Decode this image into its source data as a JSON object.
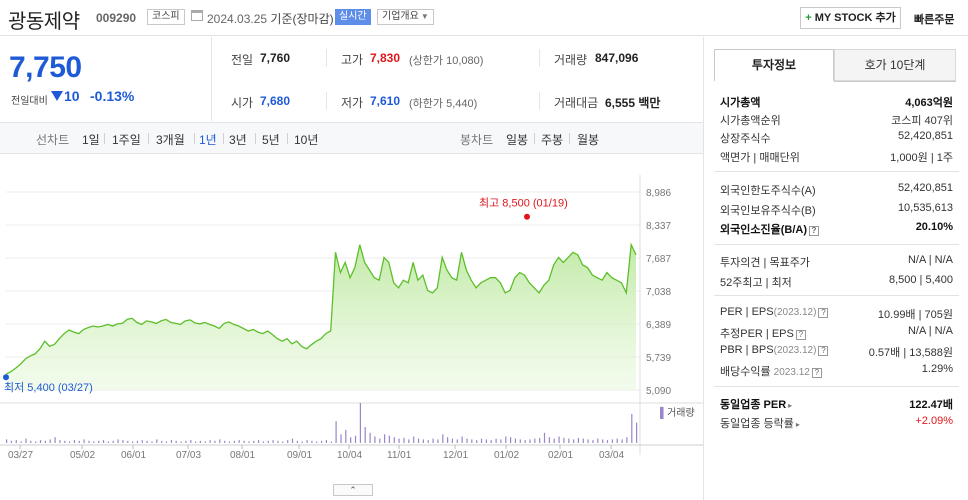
{
  "header": {
    "stock_name": "광동제약",
    "stock_code": "009290",
    "market": "코스피",
    "date": "2024.03.25",
    "basis": "기준(장마감)",
    "realtime_label": "실시간",
    "overview_label": "기업개요",
    "mystock_label": "MY STOCK 추가",
    "quick_order_label": "빠른주문"
  },
  "price": {
    "current": "7,750",
    "change_label": "전일대비",
    "change": "10",
    "change_rate": "-0.13%"
  },
  "summary": {
    "prev_close_label": "전일",
    "prev_close": "7,760",
    "high_label": "고가",
    "high": "7,830",
    "upper_limit": "(상한가 10,080)",
    "volume_label": "거래량",
    "volume": "847,096",
    "open_label": "시가",
    "open": "7,680",
    "low_label": "저가",
    "low": "7,610",
    "lower_limit": "(하한가 5,440)",
    "amount_label": "거래대금",
    "amount": "6,555",
    "amount_unit": "백만"
  },
  "periods": {
    "line_label": "선차트",
    "items": [
      "1일",
      "1주일",
      "3개월",
      "1년",
      "3년",
      "5년",
      "10년"
    ],
    "active_index": 3,
    "candle_label": "봉차트",
    "candle_items": [
      "일봉",
      "주봉",
      "월봉"
    ]
  },
  "chart_data": {
    "type": "area",
    "title": "",
    "ylim": [
      5090,
      8986
    ],
    "y_ticks": [
      "8,986",
      "8,337",
      "7,687",
      "7,038",
      "6,389",
      "5,739",
      "5,090"
    ],
    "x_ticks": [
      "03/27",
      "05/02",
      "06/01",
      "07/03",
      "08/01",
      "09/01",
      "10/04",
      "11/01",
      "12/01",
      "01/02",
      "02/01",
      "03/04"
    ],
    "high_label": "최고 8,500 (01/19)",
    "low_label": "최저 5,400 (03/27)",
    "volume_label": "거래량",
    "price_values": [
      5400,
      5450,
      5520,
      5600,
      5700,
      5760,
      5800,
      5900,
      6050,
      5950,
      5990,
      6100,
      6200,
      6270,
      6230,
      6200,
      6280,
      6320,
      6350,
      6330,
      6350,
      6380,
      6350,
      6390,
      6400,
      6480,
      6500,
      6420,
      6380,
      6450,
      6430,
      6400,
      6450,
      6480,
      6420,
      6400,
      6380,
      6450,
      6470,
      6410,
      6390,
      6420,
      6380,
      6350,
      6300,
      6400,
      6430,
      6380,
      6350,
      6300,
      6250,
      6280,
      6230,
      6200,
      6250,
      6180,
      6100,
      6050,
      6100,
      6000,
      6050,
      5950,
      5900,
      5980,
      6050,
      6100,
      6200,
      6250,
      7800,
      7400,
      7600,
      7300,
      7500,
      7950,
      7600,
      7450,
      7300,
      7250,
      7700,
      7600,
      7200,
      7100,
      7250,
      7200,
      7600,
      7250,
      7350,
      7050,
      7000,
      7100,
      7700,
      7450,
      7300,
      7250,
      7800,
      7450,
      7250,
      7100,
      7200,
      7250,
      7300,
      7300,
      7200,
      7000,
      7050,
      7300,
      7400,
      7350,
      7200,
      7100,
      7000,
      7150,
      7250,
      7550,
      7700,
      7600,
      7700,
      7800,
      7750,
      7550,
      7500,
      7350,
      7300,
      7250,
      7400,
      7300,
      7250,
      7200,
      7000,
      7950,
      7750
    ],
    "volume_values": [
      5,
      3,
      4,
      2,
      6,
      3,
      2,
      4,
      3,
      5,
      8,
      4,
      3,
      2,
      4,
      3,
      5,
      3,
      2,
      3,
      4,
      2,
      3,
      5,
      4,
      3,
      2,
      3,
      4,
      3,
      2,
      5,
      3,
      2,
      4,
      3,
      2,
      3,
      4,
      2,
      3,
      2,
      4,
      3,
      5,
      3,
      2,
      3,
      4,
      3,
      2,
      3,
      4,
      2,
      3,
      4,
      3,
      2,
      4,
      6,
      3,
      2,
      4,
      3,
      2,
      3,
      4,
      2,
      30,
      12,
      18,
      8,
      10,
      55,
      22,
      14,
      9,
      6,
      12,
      10,
      8,
      6,
      7,
      5,
      9,
      6,
      5,
      4,
      6,
      5,
      12,
      8,
      6,
      5,
      9,
      6,
      5,
      4,
      6,
      5,
      4,
      6,
      5,
      9,
      8,
      6,
      5,
      4,
      5,
      6,
      7,
      14,
      8,
      6,
      9,
      7,
      6,
      5,
      7,
      6,
      5,
      4,
      6,
      5,
      4,
      5,
      6,
      5,
      8,
      40,
      28
    ]
  },
  "right_panel": {
    "tab_invest": "투자정보",
    "tab_hoga": "호가 10단계",
    "market_cap_label": "시가총액",
    "market_cap": "4,063억원",
    "market_cap_rank_label": "시가총액순위",
    "market_cap_rank": "코스피 407위",
    "shares_label": "상장주식수",
    "shares": "52,420,851",
    "par_label": "액면가 | 매매단위",
    "par": "1,000원 | 1주",
    "foreign_limit_label": "외국인한도주식수(A)",
    "foreign_limit": "52,420,851",
    "foreign_hold_label": "외국인보유주식수(B)",
    "foreign_hold": "10,535,613",
    "foreign_rate_label": "외국인소진율(B/A)",
    "foreign_rate": "20.10%",
    "opinion_label": "투자의견 | 목표주가",
    "opinion": "N/A | N/A",
    "week52_label": "52주최고 | 최저",
    "week52": "8,500 | 5,400",
    "per_label": "PER | EPS",
    "per_period": "(2023.12)",
    "per": "10.99배 | 705원",
    "est_per_label": "추정PER | EPS",
    "est_per": "N/A | N/A",
    "pbr_label": "PBR | BPS",
    "pbr_period": "(2023.12)",
    "pbr": "0.57배 | 13,588원",
    "dividend_label": "배당수익률",
    "dividend_period": "2023.12",
    "dividend": "1.29%",
    "industry_per_label": "동일업종 PER",
    "industry_per": "122.47배",
    "industry_rate_label": "동일업종 등락률",
    "industry_rate": "+2.09%"
  }
}
